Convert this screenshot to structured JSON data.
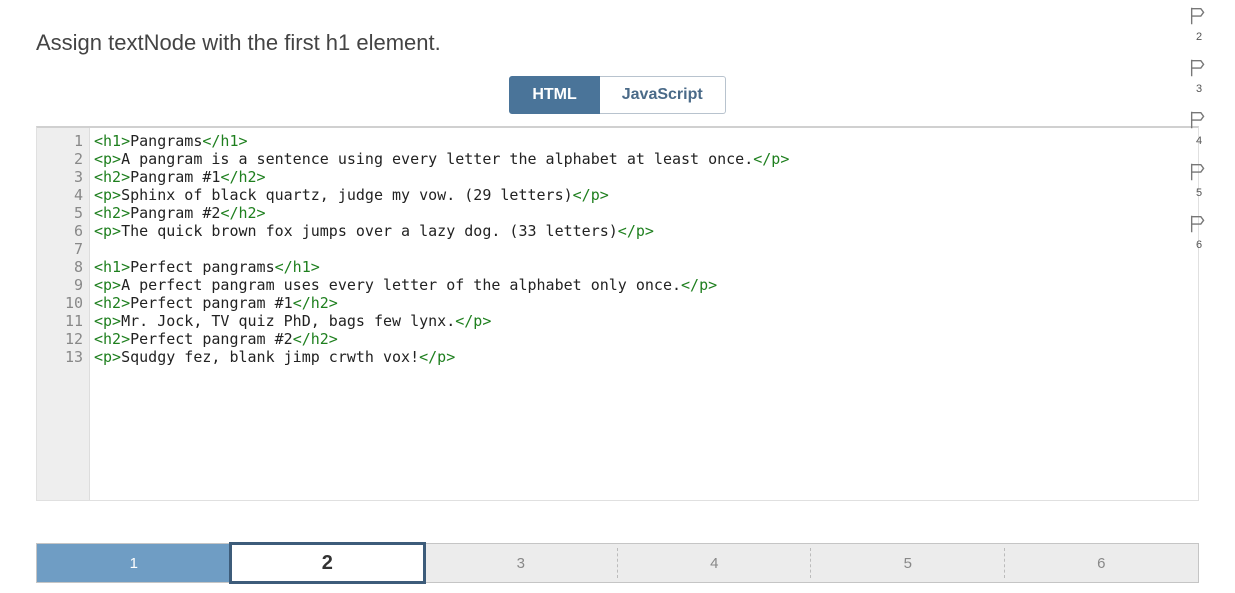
{
  "question": "Assign textNode with the first h1 element.",
  "tabs": {
    "html": "HTML",
    "js": "JavaScript",
    "active": 0
  },
  "code": [
    [
      [
        "tag",
        "<h1>"
      ],
      [
        "text",
        "Pangrams"
      ],
      [
        "tag",
        "</h1>"
      ]
    ],
    [
      [
        "tag",
        "<p>"
      ],
      [
        "text",
        "A pangram is a sentence using every letter the alphabet at least once."
      ],
      [
        "tag",
        "</p>"
      ]
    ],
    [
      [
        "tag",
        "<h2>"
      ],
      [
        "text",
        "Pangram #1"
      ],
      [
        "tag",
        "</h2>"
      ]
    ],
    [
      [
        "tag",
        "<p>"
      ],
      [
        "text",
        "Sphinx of black quartz, judge my vow. (29 letters)"
      ],
      [
        "tag",
        "</p>"
      ]
    ],
    [
      [
        "tag",
        "<h2>"
      ],
      [
        "text",
        "Pangram #2"
      ],
      [
        "tag",
        "</h2>"
      ]
    ],
    [
      [
        "tag",
        "<p>"
      ],
      [
        "text",
        "The quick brown fox jumps over a lazy dog. (33 letters)"
      ],
      [
        "tag",
        "</p>"
      ]
    ],
    [],
    [
      [
        "tag",
        "<h1>"
      ],
      [
        "text",
        "Perfect pangrams"
      ],
      [
        "tag",
        "</h1>"
      ]
    ],
    [
      [
        "tag",
        "<p>"
      ],
      [
        "text",
        "A perfect pangram uses every letter of the alphabet only once."
      ],
      [
        "tag",
        "</p>"
      ]
    ],
    [
      [
        "tag",
        "<h2>"
      ],
      [
        "text",
        "Perfect pangram #1"
      ],
      [
        "tag",
        "</h2>"
      ]
    ],
    [
      [
        "tag",
        "<p>"
      ],
      [
        "text",
        "Mr. Jock, TV quiz PhD, bags few lynx."
      ],
      [
        "tag",
        "</p>"
      ]
    ],
    [
      [
        "tag",
        "<h2>"
      ],
      [
        "text",
        "Perfect pangram #2"
      ],
      [
        "tag",
        "</h2>"
      ]
    ],
    [
      [
        "tag",
        "<p>"
      ],
      [
        "text",
        "Squdgy fez, blank jimp crwth vox!"
      ],
      [
        "tag",
        "</p>"
      ]
    ]
  ],
  "nav": {
    "items": [
      "1",
      "2",
      "3",
      "4",
      "5",
      "6"
    ],
    "completed": 0,
    "current": 1
  },
  "flags": [
    "2",
    "3",
    "4",
    "5",
    "6"
  ]
}
